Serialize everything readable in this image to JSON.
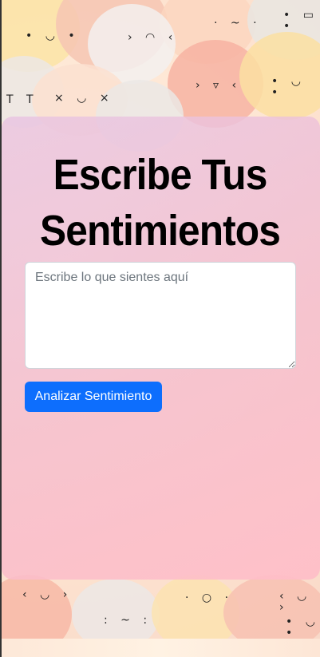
{
  "page": {
    "title": "Escribe Tus Sentimientos"
  },
  "form": {
    "textarea_placeholder": "Escribe lo que sientes aquí",
    "textarea_value": "",
    "submit_label": "Analizar Sentimiento"
  },
  "colors": {
    "button": "#0d6efd",
    "panel": "#f2bfd4",
    "title": "#000000"
  },
  "icons": [
    "watercolor-face-background"
  ]
}
